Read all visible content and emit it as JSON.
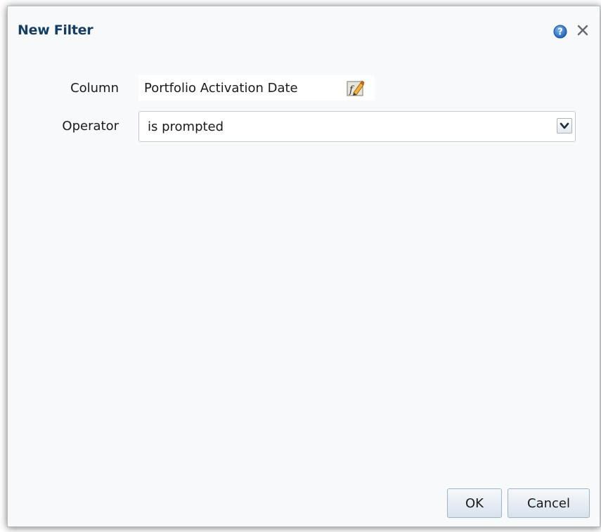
{
  "dialog": {
    "title": "New Filter",
    "help_icon": "help-icon",
    "close_icon": "close-icon"
  },
  "form": {
    "column_label": "Column",
    "column_value": "Portfolio Activation Date",
    "edit_formula_icon": "edit-formula-icon",
    "operator_label": "Operator",
    "operator_value": "is prompted"
  },
  "buttons": {
    "ok_label": "OK",
    "cancel_label": "Cancel"
  },
  "colors": {
    "title": "#153e62",
    "help_blue": "#2f7fd2",
    "dialog_bg": "#f8f9fa"
  }
}
